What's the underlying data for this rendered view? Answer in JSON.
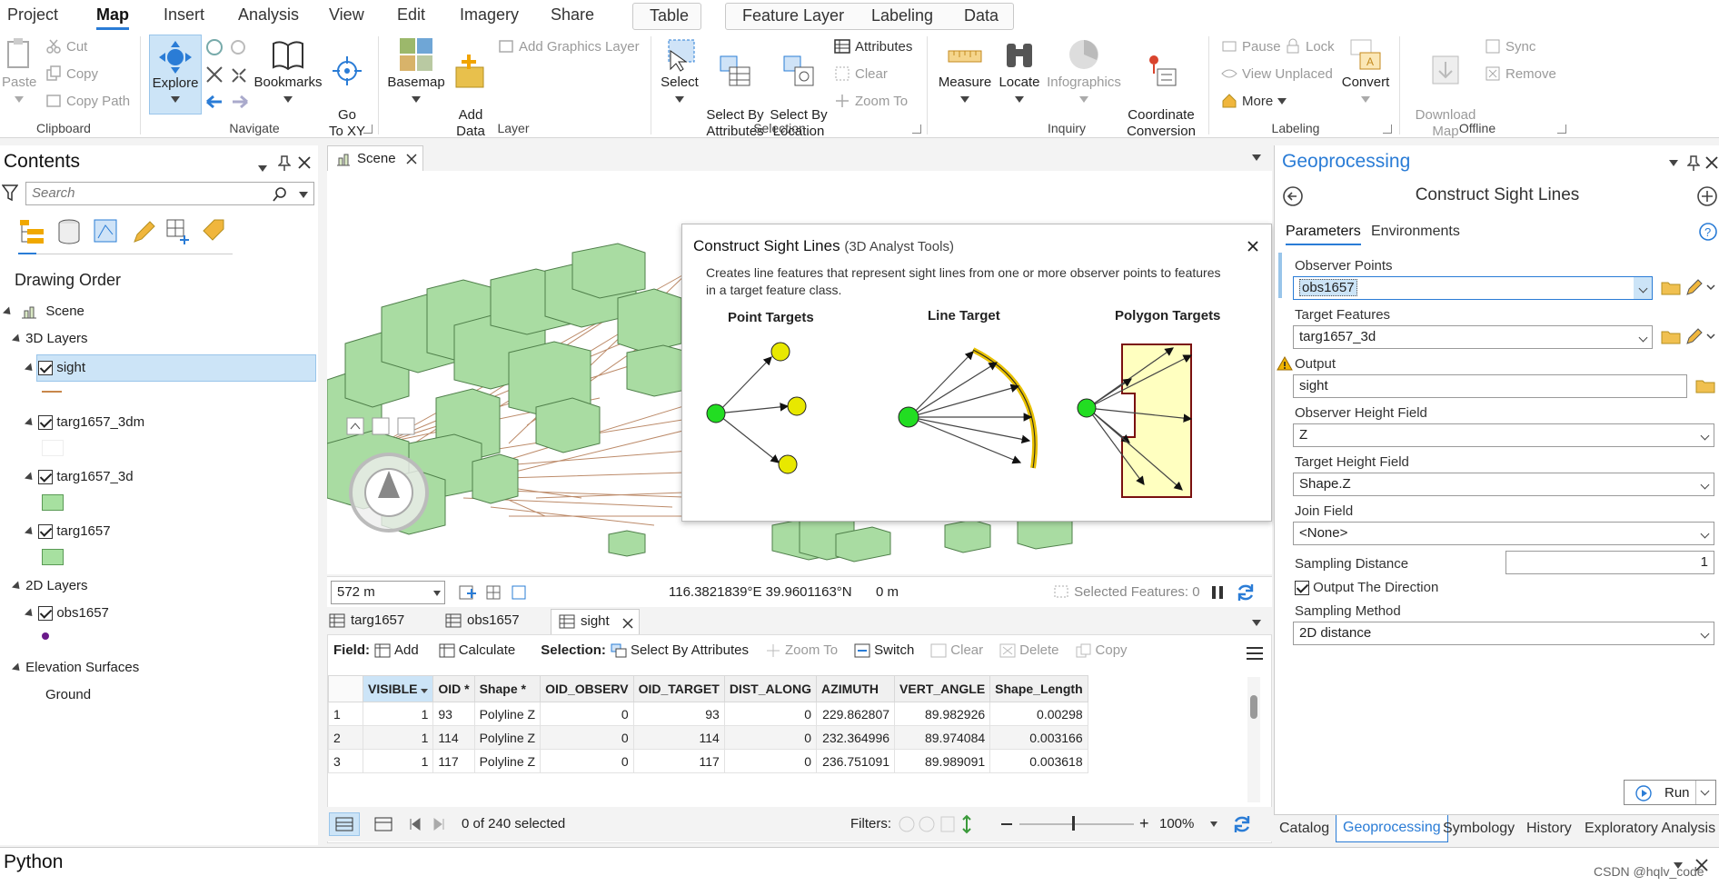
{
  "menu_tabs": [
    "Project",
    "Map",
    "Insert",
    "Analysis",
    "View",
    "Edit",
    "Imagery",
    "Share"
  ],
  "context_tabs": {
    "table": "Table",
    "feature_layer": "Feature Layer",
    "labeling": "Labeling",
    "data": "Data"
  },
  "ribbon": {
    "clipboard": {
      "paste": "Paste",
      "cut": "Cut",
      "copy": "Copy",
      "copy_path": "Copy Path",
      "group": "Clipboard"
    },
    "navigate": {
      "explore": "Explore",
      "bookmarks": "Bookmarks",
      "goto": "Go\nTo XY",
      "group": "Navigate"
    },
    "layer": {
      "basemap": "Basemap",
      "add_data": "Add\nData",
      "add_graphics": "Add Graphics Layer",
      "group": "Layer"
    },
    "selection": {
      "select": "Select",
      "select_by_attr": "Select By\nAttributes",
      "select_by_loc": "Select By\nLocation",
      "attributes": "Attributes",
      "clear": "Clear",
      "zoom_to": "Zoom To",
      "group": "Selection"
    },
    "inquiry": {
      "measure": "Measure",
      "locate": "Locate",
      "infographics": "Infographics",
      "coord": "Coordinate\nConversion",
      "group": "Inquiry"
    },
    "labeling": {
      "pause": "Pause",
      "lock": "Lock",
      "view_unplaced": "View Unplaced",
      "more": "More",
      "convert": "Convert",
      "group": "Labeling"
    },
    "offline": {
      "download": "Download\nMap",
      "sync": "Sync",
      "remove": "Remove",
      "group": "Offline"
    }
  },
  "contents": {
    "title": "Contents",
    "search_placeholder": "Search",
    "drawing_order": "Drawing Order",
    "scene": "Scene",
    "layers3d": "3D Layers",
    "sight": "sight",
    "targ3dm": "targ1657_3dm",
    "targ3d": "targ1657_3d",
    "targ": "targ1657",
    "layers2d": "2D Layers",
    "obs": "obs1657",
    "elev": "Elevation Surfaces",
    "ground": "Ground"
  },
  "scene_tab": "Scene",
  "scene_status": {
    "scale": "572 m",
    "coords": "116.3821839°E 39.9601163°N",
    "elev": "0 m",
    "selected": "Selected Features: 0"
  },
  "popup": {
    "title": "Construct Sight Lines",
    "toolbox": "(3D Analyst Tools)",
    "desc": "Creates line features that represent sight lines from one or more observer points to features in a target feature class.",
    "lbl_point": "Point Targets",
    "lbl_line": "Line Target",
    "lbl_poly": "Polygon Targets"
  },
  "table_tabs": [
    "targ1657",
    "obs1657",
    "sight"
  ],
  "table_toolbar": {
    "field": "Field:",
    "add": "Add",
    "calculate": "Calculate",
    "selection": "Selection:",
    "select_by_attr": "Select By Attributes",
    "zoom_to": "Zoom To",
    "switch": "Switch",
    "clear": "Clear",
    "delete": "Delete",
    "copy": "Copy"
  },
  "table": {
    "columns": [
      "VISIBLE",
      "OID *",
      "Shape *",
      "OID_OBSERV",
      "OID_TARGET",
      "DIST_ALONG",
      "AZIMUTH",
      "VERT_ANGLE",
      "Shape_Length"
    ],
    "rows": [
      [
        "1",
        "1",
        "93",
        "Polyline Z",
        "0",
        "93",
        "0",
        "229.862807",
        "89.982926",
        "0.00298"
      ],
      [
        "2",
        "1",
        "114",
        "Polyline Z",
        "0",
        "114",
        "0",
        "232.364996",
        "89.974084",
        "0.003166"
      ],
      [
        "3",
        "1",
        "117",
        "Polyline Z",
        "0",
        "117",
        "0",
        "236.751091",
        "89.989091",
        "0.003618"
      ]
    ]
  },
  "table_status": {
    "selected": "0 of 240 selected",
    "filters": "Filters:",
    "zoom": "100%"
  },
  "gp": {
    "title": "Geoprocessing",
    "tool": "Construct Sight Lines",
    "tab_params": "Parameters",
    "tab_env": "Environments",
    "observer_label": "Observer Points",
    "observer_value": "obs1657",
    "target_label": "Target Features",
    "target_value": "targ1657_3d",
    "output_label": "Output",
    "output_value": "sight",
    "obs_height_label": "Observer Height Field",
    "obs_height_value": "Z",
    "tgt_height_label": "Target Height Field",
    "tgt_height_value": "Shape.Z",
    "join_label": "Join Field",
    "join_value": "<None>",
    "sampling_label": "Sampling Distance",
    "sampling_value": "1",
    "direction_label": "Output The Direction",
    "method_label": "Sampling Method",
    "method_value": "2D distance",
    "run": "Run"
  },
  "bottom_tabs": [
    "Catalog",
    "Geoprocessing",
    "Symbology",
    "History",
    "Exploratory Analysis"
  ],
  "python": "Python",
  "watermark": "CSDN @hqlv_code"
}
